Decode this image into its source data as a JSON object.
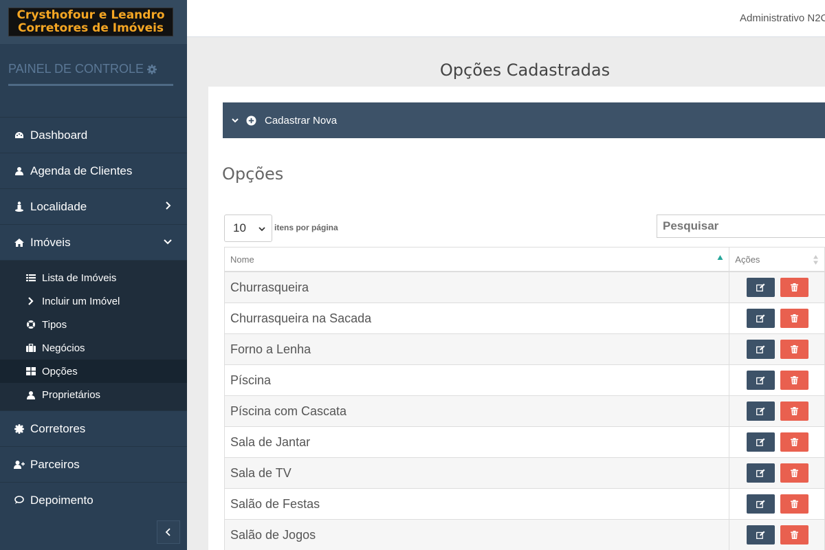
{
  "logo": {
    "line1": "Crysthofour e Leandro",
    "line2": "Corretores de Imóveis"
  },
  "sidebar": {
    "panel_title": "PAINEL DE CONTROLE",
    "items": [
      {
        "label": "Dashboard",
        "icon": "palette-icon"
      },
      {
        "label": "Agenda de Clientes",
        "icon": "user-icon"
      },
      {
        "label": "Localidade",
        "icon": "street-view-icon"
      },
      {
        "label": "Imóveis",
        "icon": "home-icon"
      },
      {
        "label": "Corretores",
        "icon": "badge-icon"
      },
      {
        "label": "Parceiros",
        "icon": "user-plus-icon"
      },
      {
        "label": "Depoimento",
        "icon": "comment-icon"
      }
    ],
    "submenu": [
      {
        "label": "Lista de Imóveis",
        "icon": "list-icon"
      },
      {
        "label": "Incluir um Imóvel",
        "icon": "chevron-right-icon"
      },
      {
        "label": "Tipos",
        "icon": "life-ring-icon"
      },
      {
        "label": "Negócios",
        "icon": "briefcase-icon"
      },
      {
        "label": "Opções",
        "icon": "th-large-icon"
      },
      {
        "label": "Proprietários",
        "icon": "user-icon"
      }
    ],
    "active_submenu": "Opções"
  },
  "topbar": {
    "admin_label": "Administrativo N2C"
  },
  "main": {
    "page_title": "Opções Cadastradas",
    "panel_label": "Cadastrar Nova",
    "section_title": "Opções",
    "length_value": "10",
    "length_label": "itens por página",
    "search_placeholder": "Pesquisar",
    "columns": [
      "Nome",
      "Ações"
    ],
    "rows": [
      "Churrasqueira",
      "Churrasqueira na Sacada",
      "Forno a Lenha",
      "Píscina",
      "Píscina com Cascata",
      "Sala de Jantar",
      "Sala de TV",
      "Salão de Festas",
      "Salão de Jogos"
    ]
  },
  "colors": {
    "sidebar": "#2a3f54",
    "accent": "#3d5268",
    "danger": "#e9604f",
    "logo_text": "#f5a623"
  }
}
